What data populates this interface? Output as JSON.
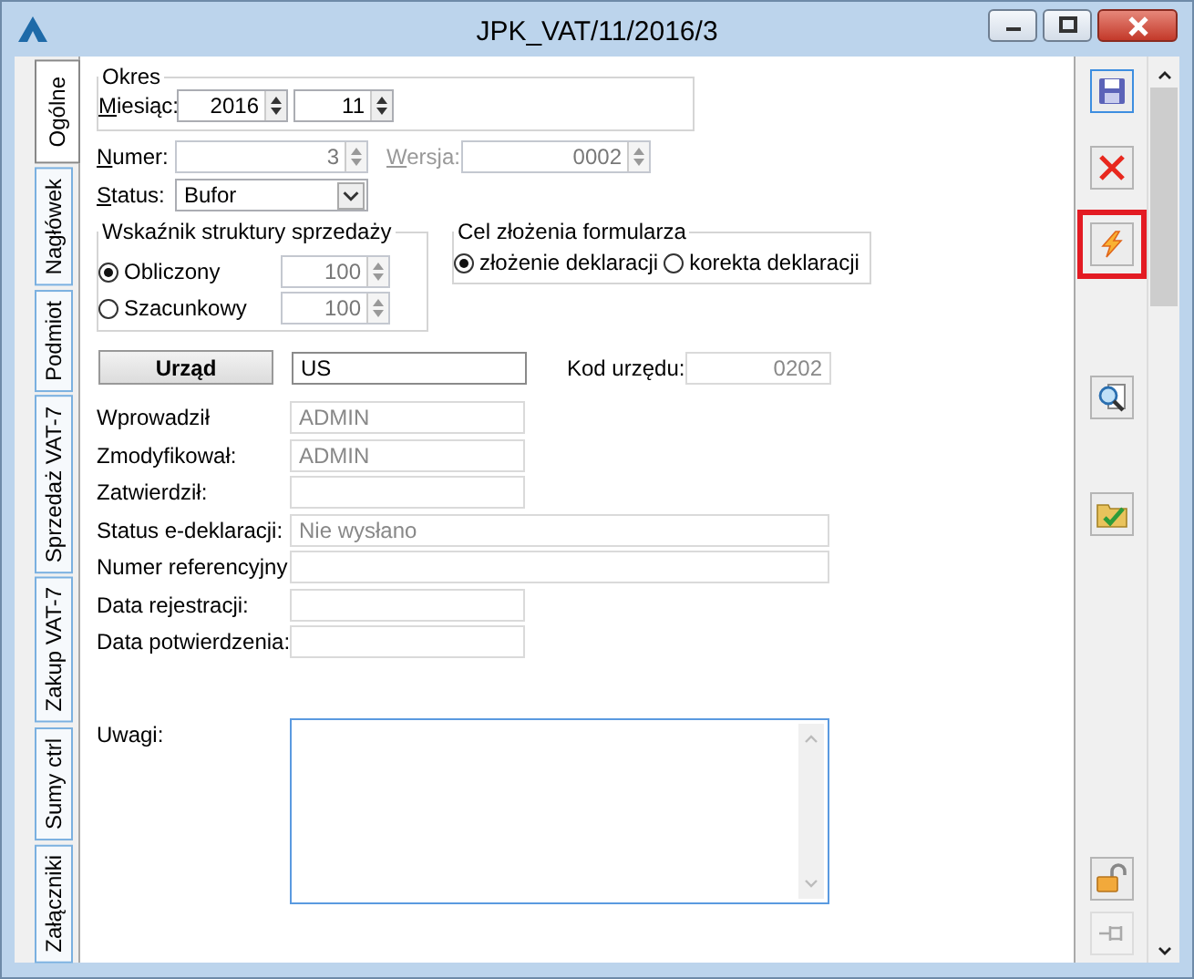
{
  "window": {
    "title": "JPK_VAT/11/2016/3"
  },
  "tabs": [
    {
      "label": "Ogólne",
      "selected": true
    },
    {
      "label": "Nagłówek",
      "selected": false
    },
    {
      "label": "Podmiot",
      "selected": false
    },
    {
      "label": "Sprzedaż VAT-7",
      "selected": false
    },
    {
      "label": "Zakup VAT-7",
      "selected": false
    },
    {
      "label": "Sumy ctrl",
      "selected": false
    },
    {
      "label": "Załączniki",
      "selected": false
    }
  ],
  "okres": {
    "title": "Okres",
    "month_label": "Miesiąc:",
    "year": "2016",
    "month": "11"
  },
  "numer": {
    "label": "Numer:",
    "value": "3",
    "disabled": true
  },
  "wersja": {
    "label": "Wersja:",
    "value": "0002",
    "disabled": true
  },
  "status": {
    "label": "Status:",
    "value": "Bufor"
  },
  "wskaznik": {
    "title": "Wskaźnik struktury sprzedaży",
    "options": [
      {
        "label": "Obliczony",
        "selected": true,
        "value": "100"
      },
      {
        "label": "Szacunkowy",
        "selected": false,
        "value": "100"
      }
    ]
  },
  "cel": {
    "title": "Cel złożenia formularza",
    "options": [
      {
        "label": "złożenie deklaracji",
        "selected": true
      },
      {
        "label": "korekta deklaracji",
        "selected": false
      }
    ]
  },
  "urzad": {
    "button": "Urząd",
    "value": "US",
    "code_label": "Kod urzędu:",
    "code": "0202"
  },
  "fields": [
    {
      "label": "Wprowadził",
      "value": "ADMIN"
    },
    {
      "label": "Zmodyfikował:",
      "value": "ADMIN"
    },
    {
      "label": "Zatwierdził:"
    },
    {
      "label": "Status e-deklaracji:",
      "value": "Nie wysłano"
    },
    {
      "label": "Numer referencyjny"
    },
    {
      "label": "Data rejestracji:"
    },
    {
      "label": "Data potwierdzenia:"
    }
  ],
  "notes": {
    "label": "Uwagi:"
  },
  "toolbar": [
    {
      "kind": "save",
      "highlighted": false
    },
    {
      "kind": "cancel",
      "highlighted": false
    },
    {
      "kind": "execute",
      "highlighted": true
    },
    {
      "kind": "preview",
      "highlighted": false
    },
    {
      "kind": "approve",
      "highlighted": false
    }
  ],
  "toolbar_bottom": [
    {
      "kind": "lock",
      "disabled": false
    },
    {
      "kind": "pin",
      "disabled": true
    }
  ]
}
